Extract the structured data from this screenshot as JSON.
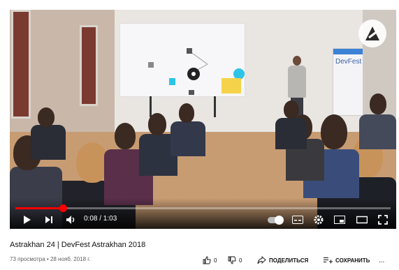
{
  "player": {
    "time_display": "0:08 / 1:03",
    "progress": 0.127,
    "banner_text": "DevFest"
  },
  "video": {
    "title": "Astrakhan 24 | DevFest Astrakhan 2018",
    "views": "73 просмотра",
    "date_sep": " • ",
    "date": "28 нояб. 2018 г."
  },
  "actions": {
    "like_count": "0",
    "dislike_count": "0",
    "share_label": "ПОДЕЛИТЬСЯ",
    "save_label": "СОХРАНИТЬ",
    "more_label": "..."
  },
  "colors": {
    "accent": "#ff0000",
    "text": "#111111",
    "meta": "#606060"
  },
  "icons": [
    "play-icon",
    "next-icon",
    "volume-icon",
    "autoplay-toggle",
    "subtitles-icon",
    "settings-icon",
    "miniplayer-icon",
    "theater-icon",
    "fullscreen-icon",
    "like-icon",
    "dislike-icon",
    "share-icon",
    "save-icon",
    "more-icon",
    "channel-logo-icon"
  ]
}
